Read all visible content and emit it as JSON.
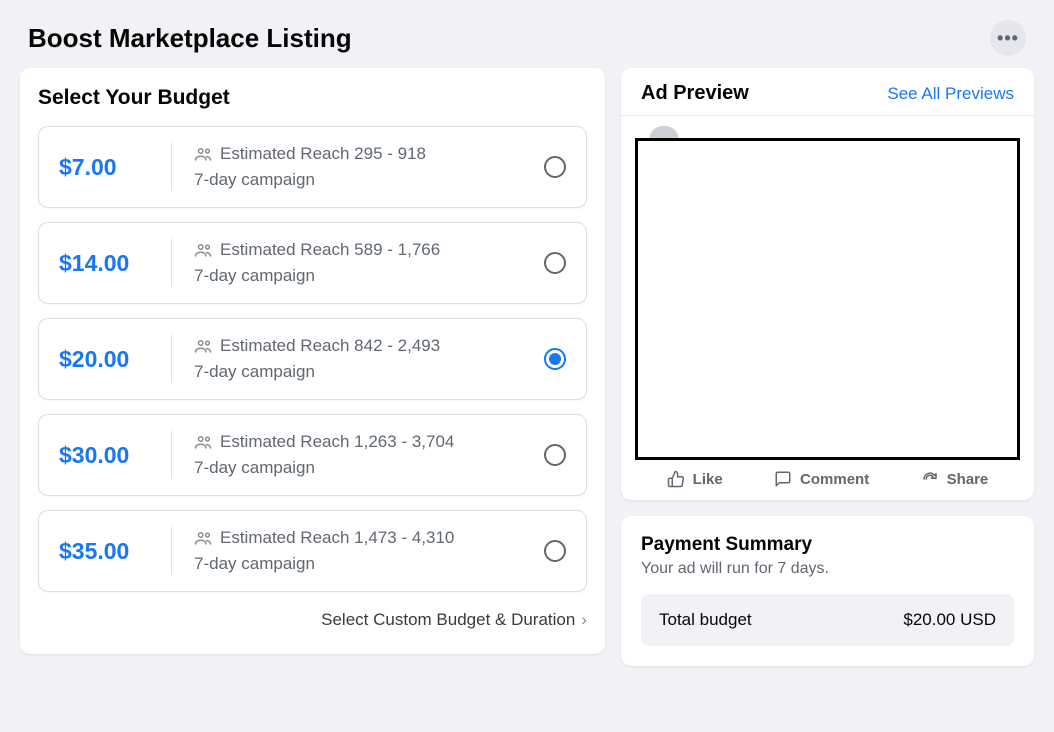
{
  "header": {
    "title": "Boost Marketplace Listing"
  },
  "budget": {
    "heading": "Select Your Budget",
    "options": [
      {
        "price": "$7.00",
        "reach": "Estimated Reach 295 - 918",
        "duration": "7-day campaign",
        "selected": false
      },
      {
        "price": "$14.00",
        "reach": "Estimated Reach 589 - 1,766",
        "duration": "7-day campaign",
        "selected": false
      },
      {
        "price": "$20.00",
        "reach": "Estimated Reach 842 - 2,493",
        "duration": "7-day campaign",
        "selected": true
      },
      {
        "price": "$30.00",
        "reach": "Estimated Reach 1,263 - 3,704",
        "duration": "7-day campaign",
        "selected": false
      },
      {
        "price": "$35.00",
        "reach": "Estimated Reach 1,473 - 4,310",
        "duration": "7-day campaign",
        "selected": false
      }
    ],
    "custom_link_label": "Select Custom Budget & Duration"
  },
  "preview": {
    "heading": "Ad Preview",
    "see_all": "See All Previews",
    "actions": {
      "like": "Like",
      "comment": "Comment",
      "share": "Share"
    }
  },
  "payment": {
    "heading": "Payment Summary",
    "subtitle": "Your ad will run for 7 days.",
    "total_label": "Total budget",
    "total_value": "$20.00 USD"
  }
}
